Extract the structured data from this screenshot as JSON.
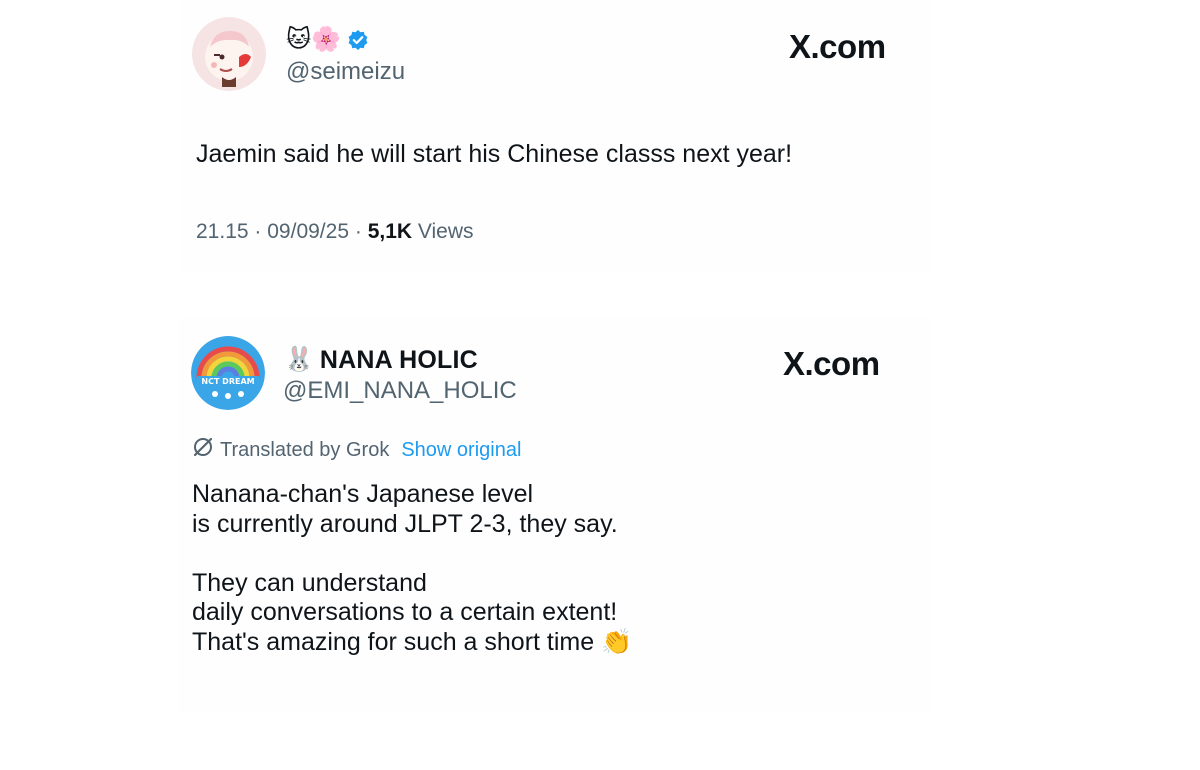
{
  "tweet1": {
    "display_emojis": "🐱🌸",
    "handle": "@seimeizu",
    "site": "X.com",
    "text": "Jaemin said he will start his Chinese classs next year!",
    "time": "21.15",
    "date": "09/09/25",
    "views_count": "5,1K",
    "views_label": "Views",
    "sep": "·",
    "icons": [
      "avatar-illustration",
      "verified-badge-icon"
    ],
    "colors": {
      "verified": "#1d9bf0",
      "avatar_bg": "#f6dede"
    }
  },
  "tweet2": {
    "display_emoji": "🐰",
    "display_name": "NANA HOLIC",
    "handle": "@EMI_NANA_HOLIC",
    "site": "X.com",
    "translated_label": "Translated by Grok",
    "show_original": "Show original",
    "text": " Nanana-chan's Japanese level\nis currently around JLPT 2-3, they say.\n\nThey can understand\ndaily conversations to a certain extent!\nThat's amazing for such a short time 👏",
    "avatar_text": "NCT DREAM",
    "icons": [
      "rainbow-avatar",
      "grok-icon"
    ],
    "colors": {
      "link": "#1d9bf0",
      "avatar_bg": "#3aa6e8"
    }
  }
}
